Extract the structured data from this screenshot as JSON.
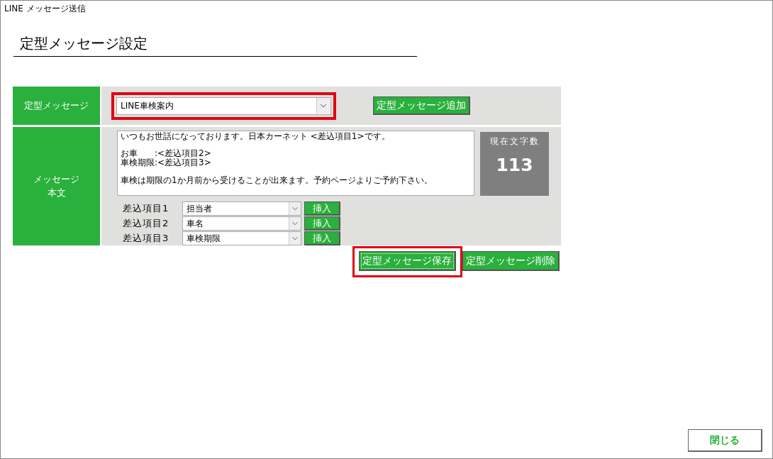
{
  "window": {
    "title": "LINE メッセージ送信"
  },
  "heading": "定型メッセージ設定",
  "template": {
    "label": "定型メッセージ",
    "value": "LINE車検案内",
    "highlighted": true,
    "add_button": "定型メッセージ追加"
  },
  "body": {
    "label": [
      "メッセージ",
      "本文"
    ],
    "paragraphs": [
      [
        "いつもお世話になっております。日本カーネット <差込項目1>です。"
      ],
      [
        "お車　　:<差込項目2>",
        "車検期限:<差込項目3>"
      ],
      [
        "車検は期限の1か月前から受けることが出来ます。予約ページよりご予約下さい。"
      ]
    ],
    "count_label": "現在文字数",
    "count": "113"
  },
  "fields": [
    {
      "label": "差込項目1",
      "value": "担当者",
      "button": "挿入"
    },
    {
      "label": "差込項目2",
      "value": "車名",
      "button": "挿入"
    },
    {
      "label": "差込項目3",
      "value": "車検期限",
      "button": "挿入"
    }
  ],
  "actions": [
    {
      "label": "定型メッセージ保存",
      "highlighted": true,
      "focused": true
    },
    {
      "label": "定型メッセージ削除",
      "highlighted": false,
      "focused": false
    }
  ],
  "close_button": "閉じる"
}
